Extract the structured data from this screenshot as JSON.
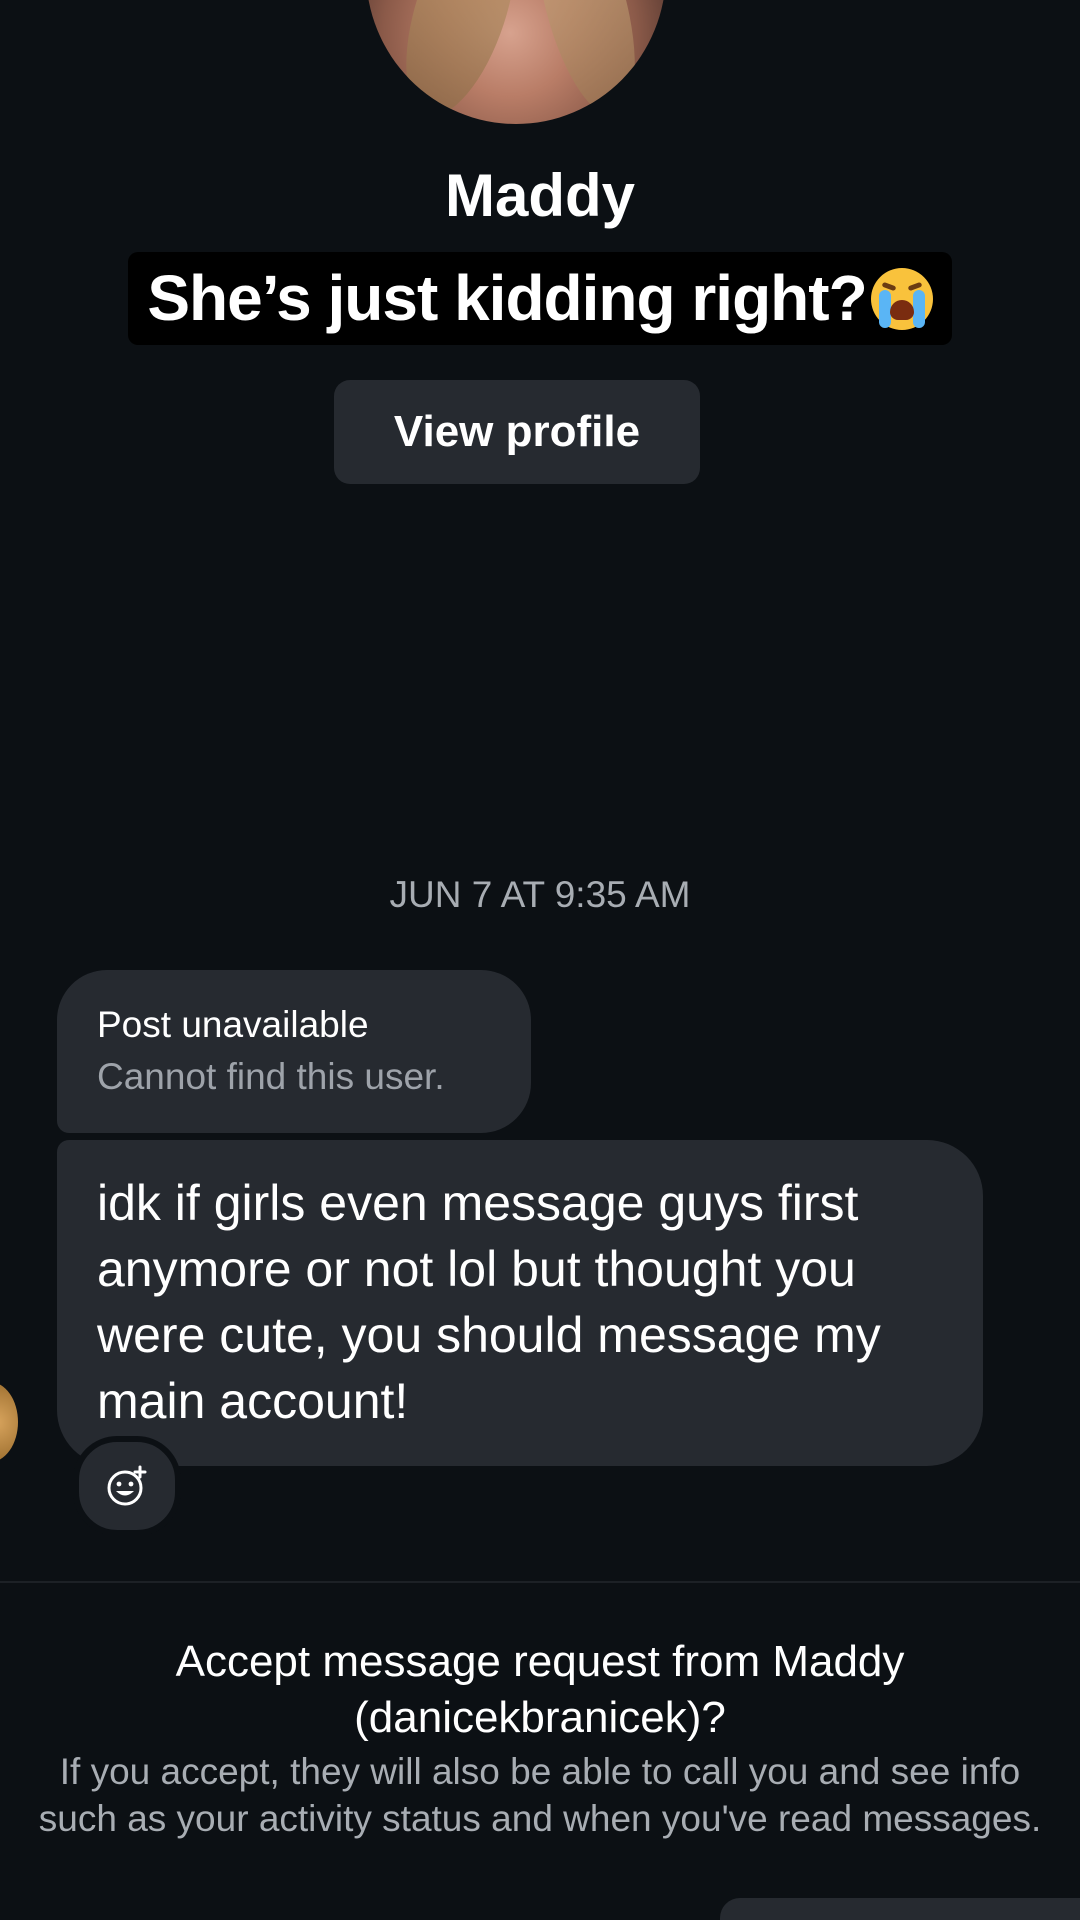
{
  "profile": {
    "name": "Maddy",
    "view_profile_label": "View profile"
  },
  "caption": {
    "text": "She’s just kidding right?",
    "emoji_icon": "loudly-crying-face-icon"
  },
  "thread": {
    "timestamp": "JUN 7 AT 9:35 AM",
    "shared_post": {
      "title": "Post unavailable",
      "subtitle": "Cannot find this user."
    },
    "message_lines": [
      "idk if girls even message guys first",
      "anymore or not lol but thought you",
      "were cute, you should message my",
      "main account!"
    ],
    "react_icon": "add-reaction-icon"
  },
  "request": {
    "title_line1": "Accept message request from Maddy",
    "title_line2": "(danicekbranicek)?",
    "info_line1": "If you accept, they will also be able to call you and see info",
    "info_line2": "such as your activity status and when you've read messages."
  },
  "colors": {
    "background": "#0c1014",
    "bubble": "#262a30",
    "secondary_text": "#a8adb3"
  }
}
